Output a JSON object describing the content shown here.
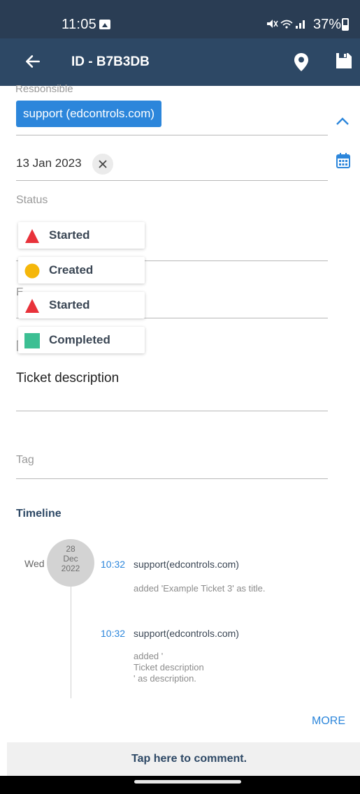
{
  "status_bar": {
    "time": "11:05",
    "battery": "37%"
  },
  "app_bar": {
    "title": "ID - B7B3DB"
  },
  "form": {
    "responsible_label": "Responsible",
    "responsible_chip": "support (edcontrols.com)",
    "due_date": "13 Jan 2023",
    "status_label": "Status",
    "description_label": "Ticket description",
    "tag_label": "Tag"
  },
  "status_options": [
    {
      "label": "Started",
      "symbol": "triangle-icon",
      "color": "#e8323a"
    },
    {
      "label": "Created",
      "symbol": "circle-icon",
      "color": "#f5b70a"
    },
    {
      "label": "Started",
      "symbol": "triangle-icon",
      "color": "#e8323a"
    },
    {
      "label": "Completed",
      "symbol": "square-icon",
      "color": "#3cbf93"
    }
  ],
  "timeline": {
    "title": "Timeline",
    "weekday": "Wed",
    "day": "28",
    "month": "Dec",
    "year": "2022",
    "entries": [
      {
        "time": "10:32",
        "user": "support(edcontrols.com)",
        "text_lines": [
          "added 'Example Ticket 3' as title."
        ]
      },
      {
        "time": "10:32",
        "user": "support(edcontrols.com)",
        "text_lines": [
          "added '",
          "Ticket description",
          "' as description."
        ]
      }
    ],
    "more_label": "MORE"
  },
  "comment": {
    "label": "Tap here to comment."
  }
}
